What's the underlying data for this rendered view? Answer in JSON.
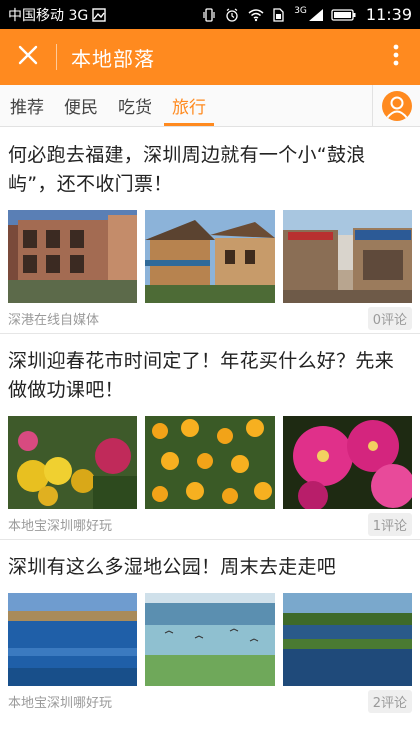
{
  "status_bar": {
    "carrier": "中国移动 3G",
    "time": "11:39",
    "network": "3G"
  },
  "app_bar": {
    "title": "本地部落",
    "background": "#ff8a1f"
  },
  "tabs": [
    {
      "label": "推荐",
      "active": false
    },
    {
      "label": "便民",
      "active": false
    },
    {
      "label": "吃货",
      "active": false
    },
    {
      "label": "旅行",
      "active": true
    }
  ],
  "articles": [
    {
      "title": "何必跑去福建，深圳周边就有一个小“鼓浪屿”，还不收门票！",
      "source": "深港在线自媒体",
      "comments": "0评论",
      "images": [
        "old-villa-photo",
        "wooden-houses-photo",
        "village-street-photo"
      ]
    },
    {
      "title": "深圳迎春花市时间定了！年花买什么好？先来做做功课吧！",
      "source": "本地宝深圳哪好玩",
      "comments": "1评论",
      "images": [
        "yellow-flowers-photo",
        "kumquat-tree-photo",
        "pink-flowers-photo"
      ]
    },
    {
      "title": "深圳有这么多湿地公园！周末去走走吧",
      "source": "本地宝深圳哪好玩",
      "comments": "2评论",
      "images": [
        "lake-photo",
        "wetland-birds-photo",
        "wetland-lake-photo"
      ]
    }
  ]
}
